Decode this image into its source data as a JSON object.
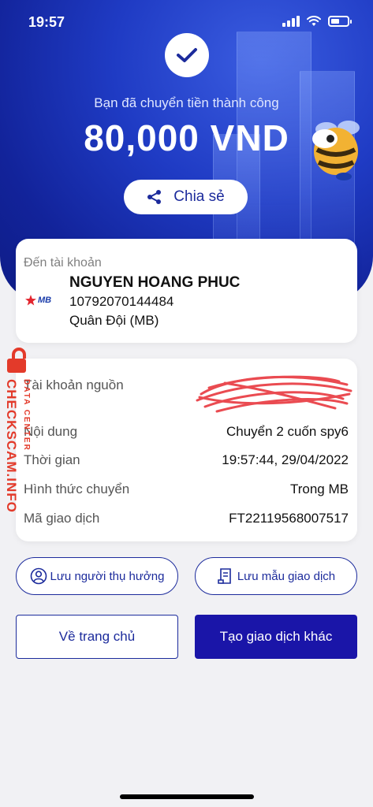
{
  "status_bar": {
    "time": "19:57"
  },
  "header": {
    "success_message": "Bạn đã chuyển tiền thành công",
    "amount": "80,000 VND",
    "share_label": "Chia sẻ"
  },
  "recipient": {
    "caption": "Đến tài khoản",
    "bank_logo_text": "MB",
    "name": "NGUYEN HOANG PHUC",
    "account_number": "10792070144484",
    "bank_name": "Quân Đội (MB)"
  },
  "details": [
    {
      "label": "Tài khoản nguồn",
      "value": ""
    },
    {
      "label": "Nội dung",
      "value": "Chuyển 2 cuốn spy6"
    },
    {
      "label": "Thời gian",
      "value": "19:57:44, 29/04/2022"
    },
    {
      "label": "Hình thức chuyển",
      "value": "Trong MB"
    },
    {
      "label": "Mã giao dịch",
      "value": "FT22119568007517"
    }
  ],
  "watermark": {
    "main": "CHECKSCAM.INFO",
    "sub": "DATA CENTER"
  },
  "actions": {
    "save_beneficiary": "Lưu người thụ hưởng",
    "save_template": "Lưu mẫu giao dịch",
    "go_home": "Về trang chủ",
    "new_transaction": "Tạo giao dịch khác"
  },
  "colors": {
    "brand_blue": "#1c2b9c",
    "primary_button": "#1a15a8",
    "watermark_red": "#e33a2a"
  }
}
